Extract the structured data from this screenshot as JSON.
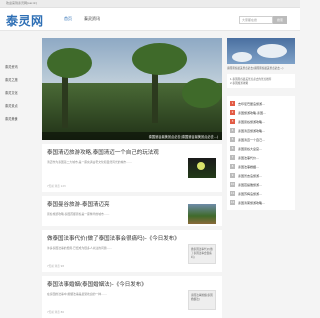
{
  "topbar": {
    "welcome": "欢迎来到泰灵网(ssr.ik)"
  },
  "header": {
    "logo": "泰灵网",
    "nav": [
      "首页",
      "泰灵资讯"
    ],
    "search_placeholder": "大家都在搜",
    "search_button": "搜索"
  },
  "sidebar": {
    "items": [
      "泰灵资讯",
      "泰灵之旅",
      "泰灵文化",
      "泰灵景点",
      "泰灵美食"
    ]
  },
  "banner": {
    "caption": "泰国曼谷最美景点必去(泰国曼谷最美景点必去...)"
  },
  "articles": [
    {
      "title": "泰国清迈旅游攻略,泰国清迈一个自己的玩法观",
      "summary": "清迈作为泰国第二大城市,是一座充满古老文化和自然风光的城市……",
      "meta": "7天前  浏览 123"
    },
    {
      "title": "泰国曼谷旅游-泰国清迈亮",
      "summary": "曼谷旅游攻略,泰国首都曼谷是一座繁华的城市……",
      "meta": ""
    },
    {
      "title": "做泰国法事代价(做了泰国法事会很痛吗)-《今日发布》",
      "summary": "许多泰国法事的费用,已经成为很多人关注的问题……",
      "meta": "7天前  浏览 98",
      "thumb_text": "做泰国法事代价(做了泰国法事会很痛吗)"
    },
    {
      "title": "泰国法事婚姻(泰国婚姻法)-《今日发布》",
      "summary": "在泰国的法事中,婚姻法事是最受欢迎的一种……",
      "meta": "7天前  浏览 86",
      "thumb_text": "泰国法事婚姻(泰国婚姻法)"
    }
  ],
  "right": {
    "banner_caption": "泰国曼谷最美景点必去(泰国曼谷最美景点必去...)",
    "box_lines": [
      "1.泰国曼谷最美景点必去的景点推荐",
      "2.泰国旅游攻略"
    ],
    "hot_list": [
      "去印尼巴厘岛旅游...",
      "泰国旅游攻略,泰国...",
      "泰国曼谷旅游攻略...",
      "泰国清迈旅游攻略...",
      "泰国清迈一个自己...",
      "泰国曼谷大皇宫...",
      "泰国法事代价...",
      "泰国法事婚姻...",
      "泰国普吉岛旅游...",
      "泰国芭提雅旅游...",
      "泰国苏梅岛旅游...",
      "泰国清莱旅游攻略..."
    ]
  },
  "colors": {
    "brand": "#2e6fb5",
    "hot": "#e25b45"
  }
}
